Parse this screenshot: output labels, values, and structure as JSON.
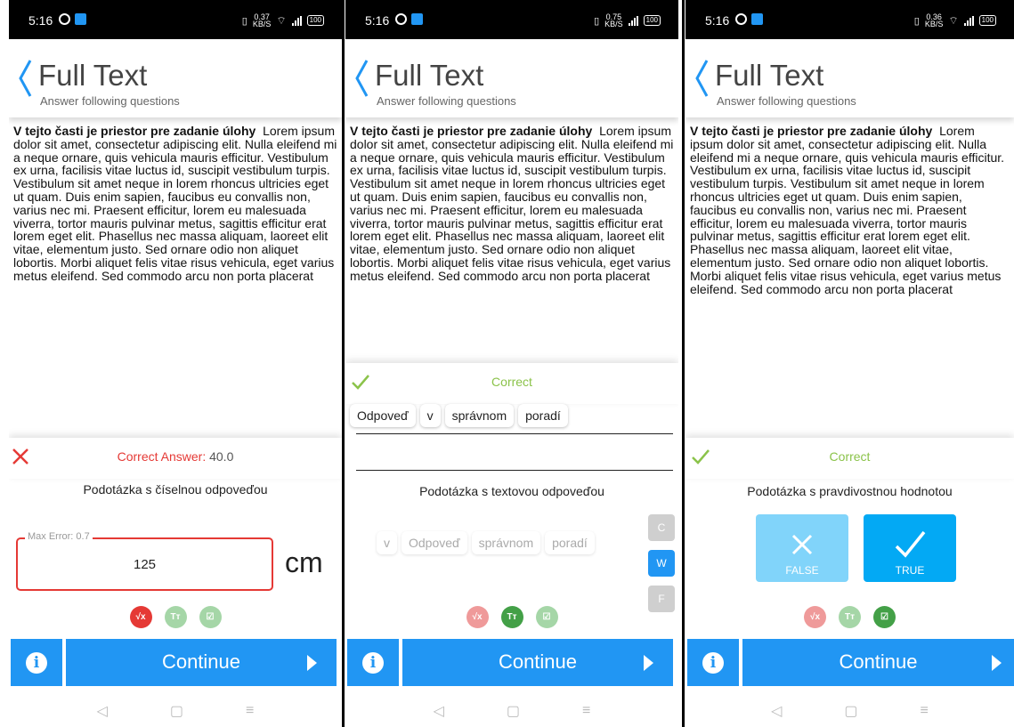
{
  "status_bar": {
    "time": "5:16",
    "battery": "100",
    "screens_net_speed": [
      "0.37",
      "0.75",
      "0.36"
    ],
    "net_unit": "KB/S"
  },
  "header": {
    "title": "Full Text",
    "subtitle": "Answer following questions"
  },
  "passage": {
    "lead": "V tejto časti je priestor pre zadanie úlohy",
    "body": "Lorem ipsum dolor sit amet, consectetur adipiscing elit. Nulla eleifend mi a neque ornare, quis vehicula mauris efficitur. Vestibulum ex urna, facilisis vitae luctus id, suscipit vestibulum turpis. Vestibulum sit amet neque in lorem rhoncus ultricies eget ut quam. Duis enim sapien, faucibus eu convallis non, varius nec mi. Praesent efficitur, lorem eu malesuada viverra, tortor mauris pulvinar metus, sagittis efficitur erat lorem eget elit. Phasellus nec massa aliquam, laoreet elit vitae, elementum justo. Sed ornare odio non aliquet lobortis. Morbi aliquet felis vitae risus vehicula, eget varius metus eleifend. Sed commodo arcu non porta placerat"
  },
  "screen1": {
    "feedback_label": "Correct Answer:",
    "feedback_value": "40.0",
    "question": "Podotázka s číselnou odpoveďou",
    "field_legend": "Max Error: 0.7",
    "field_value": "125",
    "unit": "cm"
  },
  "screen2": {
    "feedback": "Correct",
    "answer_chips": [
      "Odpoveď",
      "v",
      "správnom",
      "poradí"
    ],
    "question": "Podotázka s textovou odpoveďou",
    "option_chips": [
      "v",
      "Odpoveď",
      "správnom",
      "poradí"
    ],
    "side_buttons": [
      "C",
      "W",
      "F"
    ]
  },
  "screen3": {
    "feedback": "Correct",
    "question": "Podotázka s pravdivostnou hodnotou",
    "false_label": "FALSE",
    "true_label": "TRUE"
  },
  "footer": {
    "continue_label": "Continue",
    "info_label": "i"
  },
  "colors": {
    "accent": "#2196f3",
    "error": "#e53935",
    "success": "#8bc34a",
    "active_green": "#43a047",
    "light_blue": "#81d4fa",
    "bright_blue": "#03a9f4"
  }
}
